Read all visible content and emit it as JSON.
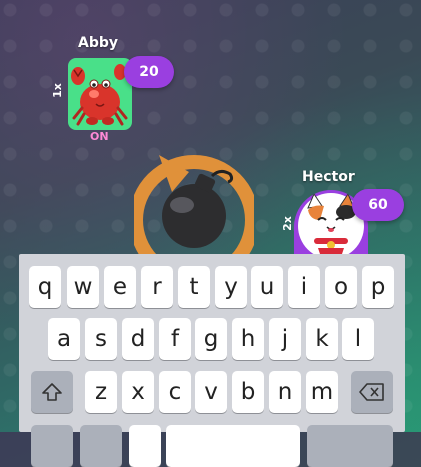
{
  "players": [
    {
      "name": "Abby",
      "multiplier": "1x",
      "score": "20",
      "status": "ON",
      "avatar": "crab"
    },
    {
      "name": "Hector",
      "multiplier": "2x",
      "score": "60",
      "avatar": "lucky-cat"
    }
  ],
  "keyboard": {
    "row1": [
      "q",
      "w",
      "e",
      "r",
      "t",
      "y",
      "u",
      "i",
      "o",
      "p"
    ],
    "row2": [
      "a",
      "s",
      "d",
      "f",
      "g",
      "h",
      "j",
      "k",
      "l"
    ],
    "row3": [
      "z",
      "x",
      "c",
      "v",
      "b",
      "n",
      "m"
    ],
    "shift_icon": "shift-icon",
    "backspace_icon": "backspace-icon"
  },
  "colors": {
    "badge": "#9a3fe0",
    "status_on": "#ff8ad6",
    "keyboard_bg": "#d1d3d9"
  }
}
